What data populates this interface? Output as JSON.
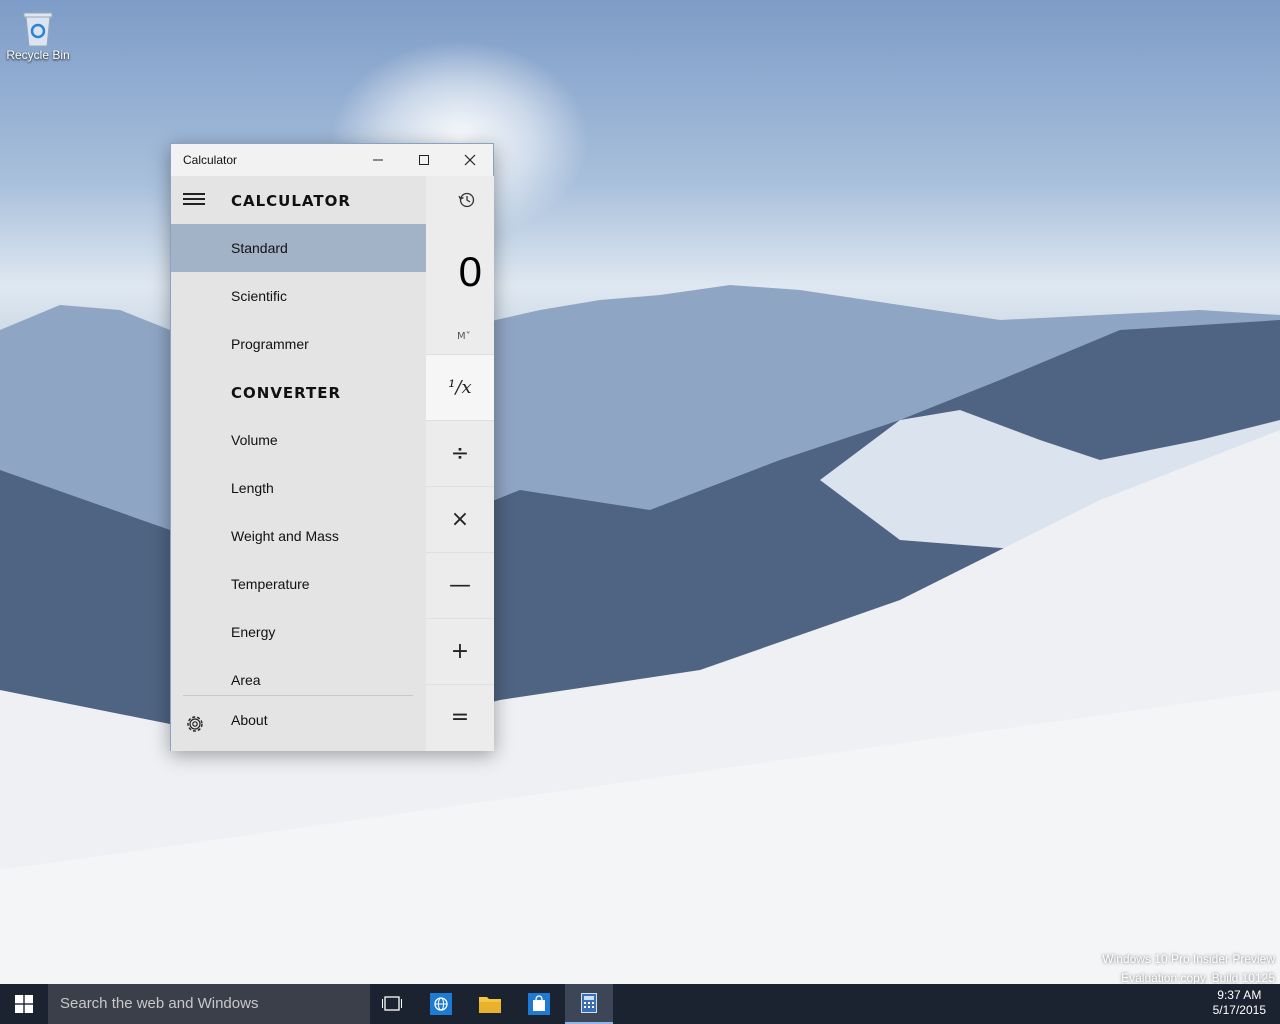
{
  "desktop": {
    "recycle_bin_label": "Recycle Bin",
    "watermark_line1": "Windows 10 Pro Insider Preview",
    "watermark_line2": "Evaluation copy. Build 10125"
  },
  "window": {
    "title": "Calculator",
    "nav": {
      "header": "CALCULATOR",
      "calculator_items": [
        {
          "label": "Standard",
          "selected": true
        },
        {
          "label": "Scientific",
          "selected": false
        },
        {
          "label": "Programmer",
          "selected": false
        }
      ],
      "converter_header": "CONVERTER",
      "converter_items": [
        {
          "label": "Volume"
        },
        {
          "label": "Length"
        },
        {
          "label": "Weight and Mass"
        },
        {
          "label": "Temperature"
        },
        {
          "label": "Energy"
        },
        {
          "label": "Area"
        }
      ],
      "about_label": "About"
    },
    "display_value": "0",
    "memory_label": "M˅",
    "keys": [
      "¹/x",
      "÷",
      "×",
      "—",
      "+",
      "="
    ]
  },
  "taskbar": {
    "search_placeholder": "Search the web and Windows",
    "time": "9:37 AM",
    "date": "5/17/2015"
  },
  "colors": {
    "selected_nav": "#a3b3c7",
    "taskbar": "#1c2330",
    "nav_bg": "#e4e4e4"
  }
}
